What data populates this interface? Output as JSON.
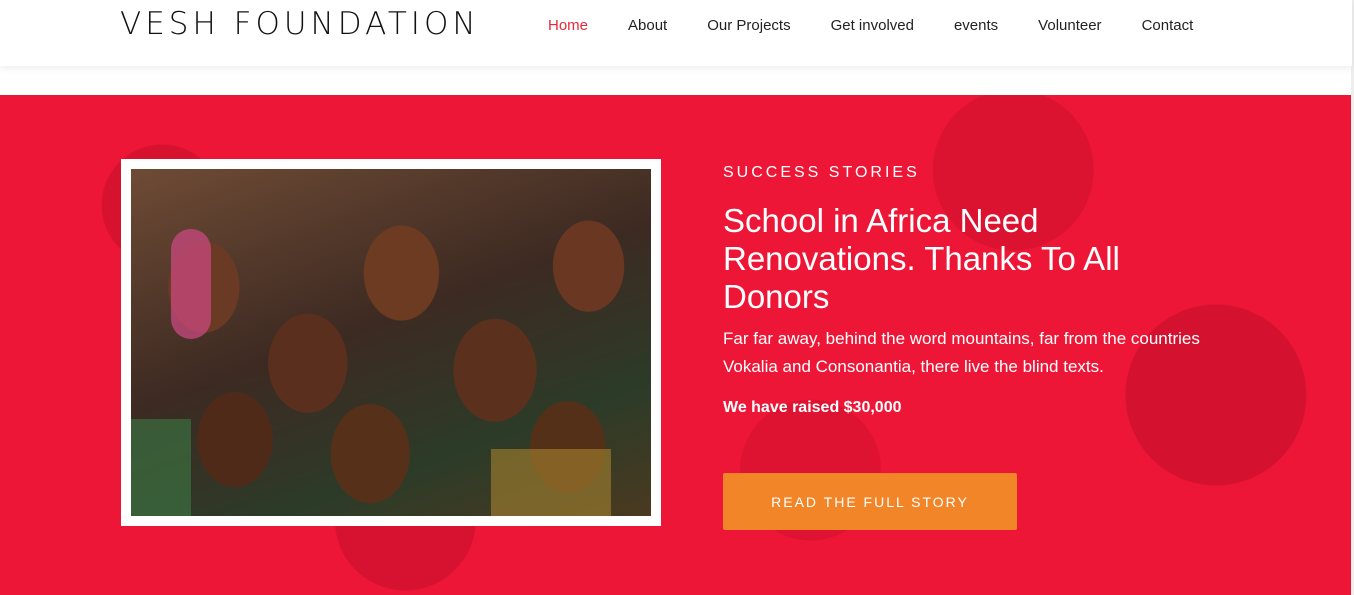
{
  "header": {
    "brand": "VESH FOUNDATION",
    "nav": [
      {
        "label": "Home",
        "active": true
      },
      {
        "label": "About"
      },
      {
        "label": "Our Projects"
      },
      {
        "label": "Get involved"
      },
      {
        "label": "events"
      },
      {
        "label": "Volunteer"
      },
      {
        "label": "Contact"
      }
    ]
  },
  "hero": {
    "eyebrow": "SUCCESS STORIES",
    "title_line1": "School in Africa Need",
    "title_line2": "Renovations. Thanks To All",
    "title_line3": "Donors",
    "body": "Far far away, behind the word mountains, far from the countries Vokalia and Consonantia, there live the blind texts.",
    "raised": "We have raised $30,000",
    "cta": "READ THE FULL STORY"
  },
  "colors": {
    "accent_red": "#ee1636",
    "active_nav": "#e8283a",
    "cta_orange": "#f28528"
  },
  "icons": {
    "photo": "children-smiling-photo"
  }
}
